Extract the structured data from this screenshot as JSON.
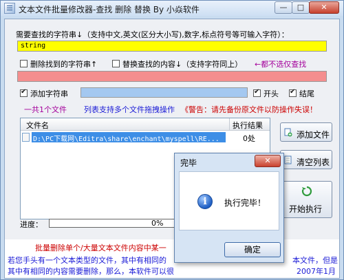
{
  "window": {
    "title": "文本文件批量修改器-查找 删除 替换 By 小焱软件",
    "min_label": "—",
    "max_label": "□",
    "close_label": "✕"
  },
  "search": {
    "label": "需要查找的字符串↓（支持中文,英文(区分大小写),数字,标点符号等可输入字符）：",
    "value": "string",
    "field_color": "#ffff00"
  },
  "options": {
    "delete_label": "删除找到的字符串↑",
    "replace_label": "替换查找的内容↓（支持字符同上）",
    "hint": "←都不选仅查找",
    "replace_field_color": "#f48e8e"
  },
  "add_string": {
    "label": "添加字符串",
    "field_color": "#a4c8f0",
    "start_label": "开头",
    "end_label": "结尾"
  },
  "info": {
    "count": "一共1个文件",
    "drag_tip": "列表支持多个文件拖拽操作",
    "warning": "《警告：请先备份原文件以防操作失误！"
  },
  "file_list": {
    "col_name": "文件名",
    "col_result": "执行结果",
    "rows": [
      {
        "path": "D:\\PC下载网\\Editra\\share\\enchant\\myspell\\RE...",
        "result": "0处"
      }
    ]
  },
  "buttons": {
    "add_file": "添加文件",
    "clear_list": "清空列表",
    "execute": "开始执行"
  },
  "progress": {
    "label": "进度：",
    "percent": "0%",
    "value": 0
  },
  "dialog": {
    "title": "完毕",
    "close_label": "✕",
    "message": "执行完毕！",
    "ok_label": "确定"
  },
  "footer": {
    "headline": "批量删除单个/大量文本文件内容中某一",
    "line1_left": "若您手头有一个文本类型的文件，其中有相同的",
    "line1_right": "本文件，但是",
    "line2_left": "其中有相同的内容需要删除，那么，本软件可以很",
    "line2_right": "2007年1月"
  },
  "colors": {
    "accent_red": "#cc0000",
    "accent_blue": "#1a1ad6",
    "warning_purple": "#a4009b"
  }
}
